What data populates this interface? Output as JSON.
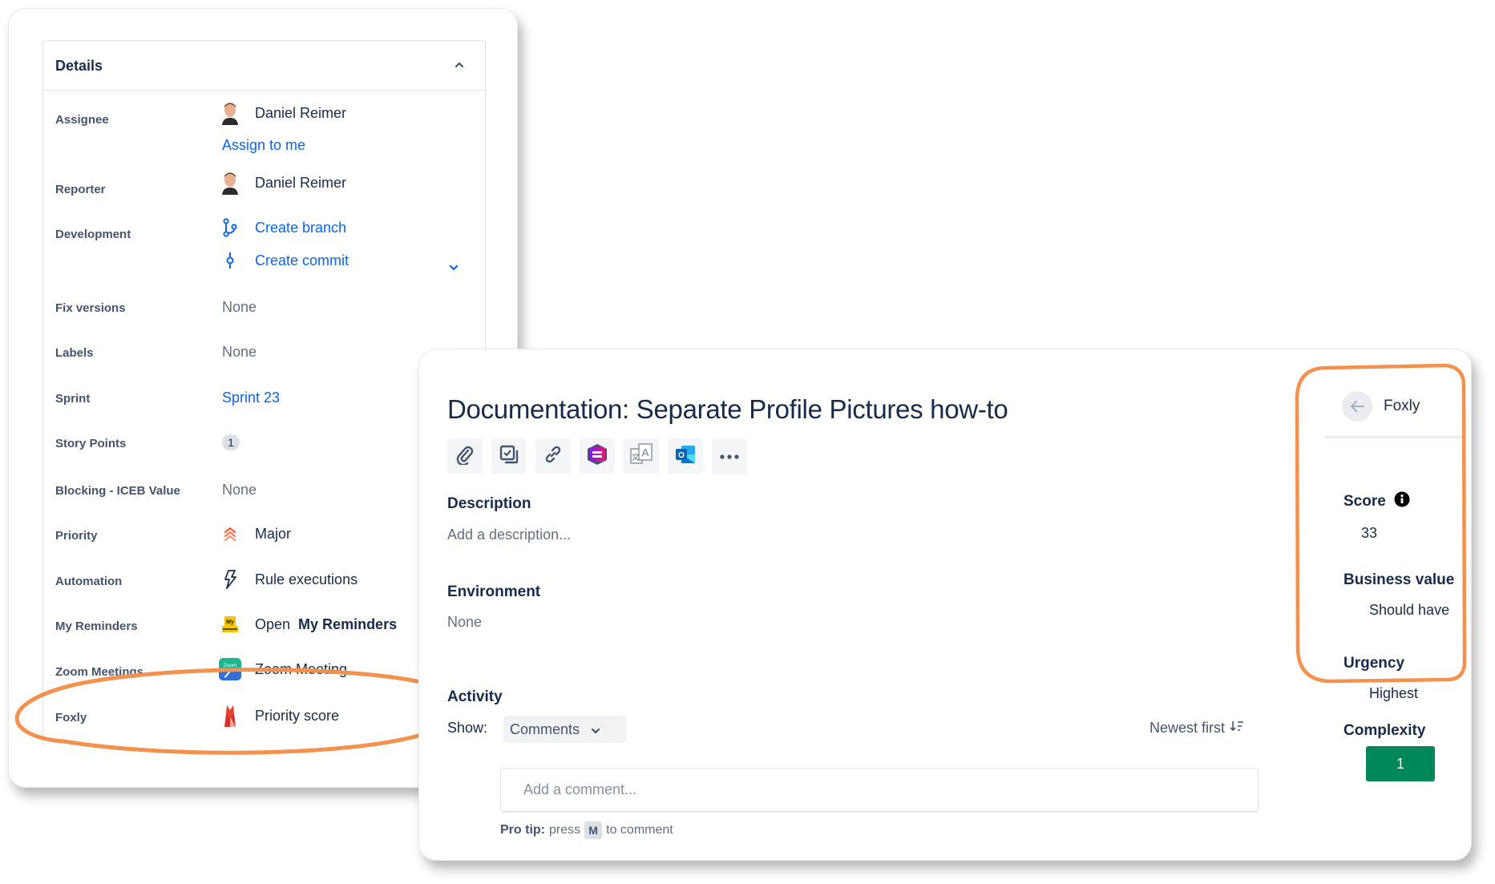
{
  "details": {
    "title": "Details",
    "rows": [
      {
        "label": "Assignee",
        "value": "Daniel Reimer",
        "action": "Assign to me"
      },
      {
        "label": "Reporter",
        "value": "Daniel Reimer"
      },
      {
        "label": "Development",
        "actions": [
          "Create branch",
          "Create commit"
        ]
      },
      {
        "label": "Fix versions",
        "value": "None"
      },
      {
        "label": "Labels",
        "value": "None"
      },
      {
        "label": "Sprint",
        "value": "Sprint 23"
      },
      {
        "label": "Story Points",
        "value": "1"
      },
      {
        "label": "Blocking - ICEB Value",
        "value": "None"
      },
      {
        "label": "Priority",
        "value": "Major",
        "icon": "priority-major-icon"
      },
      {
        "label": "Automation",
        "value": "Rule executions",
        "icon": "lightning-icon"
      },
      {
        "label": "My Reminders",
        "value_prefix": "Open ",
        "value_bold": "My Reminders",
        "icon": "my-reminders-icon"
      },
      {
        "label": "Zoom Meetings",
        "value": "Zoom Meeting",
        "icon": "zoom-app-icon"
      },
      {
        "label": "Foxly",
        "value": "Priority score",
        "icon": "foxly-icon"
      }
    ]
  },
  "issue": {
    "title": "Documentation: Separate Profile Pictures how-to",
    "toolbar": [
      "attachment-icon",
      "child-issue-icon",
      "link-icon",
      "app-icon",
      "translate-icon",
      "outlook-icon",
      "more-icon"
    ],
    "description_label": "Description",
    "description_placeholder": "Add a description...",
    "environment_label": "Environment",
    "environment_value": "None",
    "activity_label": "Activity",
    "show_label": "Show:",
    "show_selected": "Comments",
    "sort_label": "Newest first",
    "comment_placeholder": "Add a comment...",
    "pro_tip_bold": "Pro tip:",
    "pro_tip_press": "press",
    "pro_tip_key": "M",
    "pro_tip_suffix": "to comment"
  },
  "foxly": {
    "title": "Foxly",
    "score_label": "Score",
    "score_value": "33",
    "business_value_label": "Business value",
    "business_value": "Should have",
    "urgency_label": "Urgency",
    "urgency_value": "Highest",
    "complexity_label": "Complexity",
    "complexity_value": "1"
  },
  "colors": {
    "highlight": "#f5914f",
    "link": "#0c66e4",
    "complexity": "#00875a",
    "priority": "#ff5630"
  }
}
